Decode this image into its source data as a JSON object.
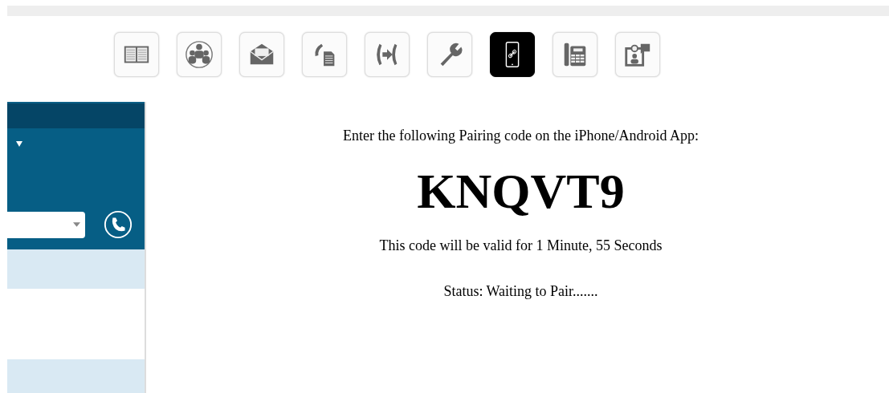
{
  "toolbar": [
    {
      "kind": "book",
      "selected": false
    },
    {
      "kind": "group",
      "selected": false
    },
    {
      "kind": "mail",
      "selected": false
    },
    {
      "kind": "fax",
      "selected": false
    },
    {
      "kind": "transfer",
      "selected": false
    },
    {
      "kind": "wrench",
      "selected": false
    },
    {
      "kind": "mobile",
      "selected": true
    },
    {
      "kind": "deskphone",
      "selected": false
    },
    {
      "kind": "video",
      "selected": false
    }
  ],
  "sidebar": {
    "rows": [
      {
        "kind": "shaded"
      },
      {
        "kind": "plain"
      },
      {
        "kind": "shaded"
      }
    ]
  },
  "pairing": {
    "instruction": "Enter the following Pairing code on the iPhone/Android App:",
    "code": "KNQVT9",
    "validity": "This code will be valid for 1 Minute, 55 Seconds",
    "status": "Status: Waiting to Pair......."
  }
}
